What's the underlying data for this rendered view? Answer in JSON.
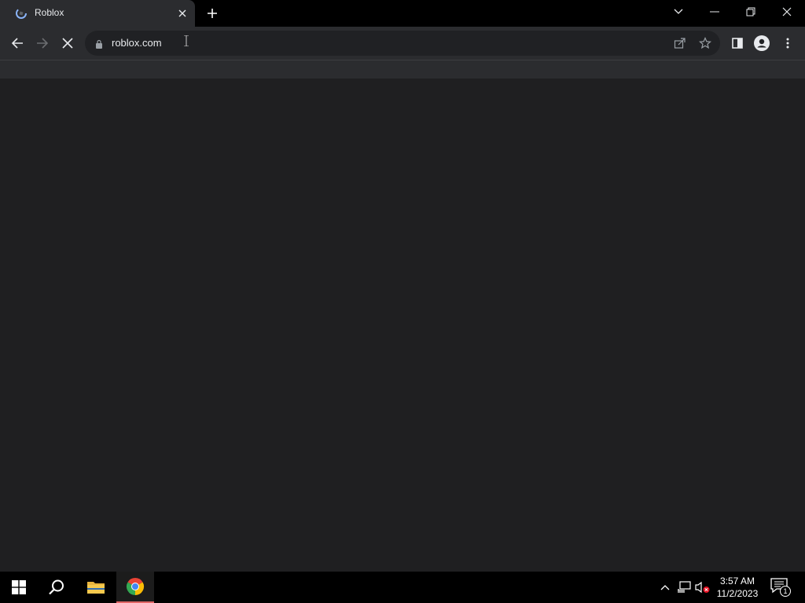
{
  "browser": {
    "tab": {
      "title": "Roblox"
    },
    "address_bar": {
      "url": "roblox.com"
    }
  },
  "taskbar": {
    "clock": {
      "time": "3:57 AM",
      "date": "11/2/2023"
    },
    "notifications_count": "1"
  },
  "colors": {
    "window_bg": "#1f1f21",
    "toolbar_bg": "#2b2c2f",
    "titlebar_bg": "#000000",
    "omnibox_bg": "#202124",
    "chrome_red": "#ea4335",
    "chrome_green": "#34a853",
    "chrome_yellow": "#fbbc05",
    "chrome_blue": "#4285f4"
  },
  "icons": {
    "tab_favicon": "roblox-loading-icon",
    "tab_close": "close-icon",
    "new_tab": "plus-icon",
    "tab_search": "chevron-down-icon",
    "minimize": "minimize-icon",
    "restore": "restore-icon",
    "close_window": "close-icon",
    "back": "arrow-left-icon",
    "forward": "arrow-right-icon",
    "stop": "stop-icon",
    "lock": "lock-icon",
    "share": "share-icon",
    "bookmark": "star-icon",
    "side_panel": "side-panel-icon",
    "profile": "profile-icon",
    "menu": "kebab-menu-icon",
    "start": "windows-icon",
    "search": "search-icon",
    "file_explorer": "folder-icon",
    "chrome": "chrome-icon",
    "tray_expand": "chevron-up-icon",
    "network": "network-icon",
    "volume": "volume-muted-icon",
    "action_center": "notification-icon"
  }
}
